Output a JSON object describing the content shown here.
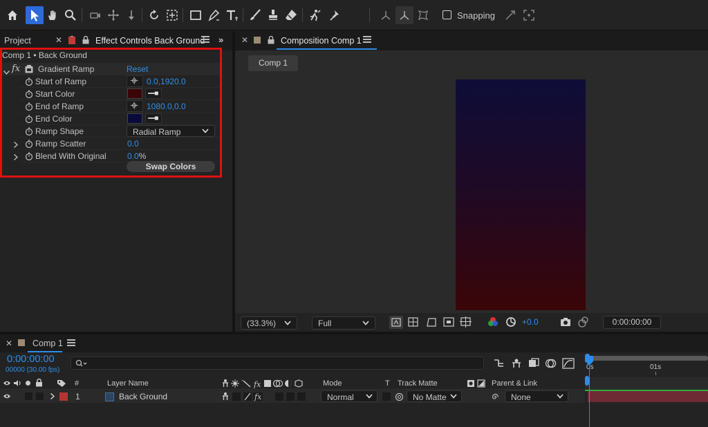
{
  "toolbar": {
    "snapping_label": "Snapping",
    "tools": [
      "home-icon",
      "selection-arrow-icon",
      "hand-icon",
      "zoom-icon",
      "orbit-camera-icon",
      "pan-behind-icon",
      "track-z-icon",
      "rotate-icon",
      "anchor-point-icon",
      "rectangle-icon",
      "pen-icon",
      "type-icon",
      "brush-icon",
      "clone-stamp-icon",
      "eraser-icon",
      "roto-brush-icon",
      "puppet-pin-icon"
    ]
  },
  "project_panel": {
    "tab_label": "Project"
  },
  "effect_controls": {
    "tab_label": "Effect Controls Back Ground",
    "breadcrumb": "Comp 1 • Back Ground",
    "effect_name": "Gradient Ramp",
    "reset_label": "Reset",
    "fx_label": "fx",
    "properties": [
      {
        "label": "Start of Ramp",
        "value": "0.0,1920.0"
      },
      {
        "label": "Start Color",
        "color": "#3a0508"
      },
      {
        "label": "End of Ramp",
        "value": "1080.0,0.0"
      },
      {
        "label": "End Color",
        "color": "#0a0a3a"
      },
      {
        "label": "Ramp Shape",
        "value": "Radial Ramp"
      },
      {
        "label": "Ramp Scatter",
        "value": "0.0"
      },
      {
        "label": "Blend With Original",
        "value": "0.0",
        "unit": "%"
      }
    ],
    "swap_label": "Swap Colors"
  },
  "composition": {
    "tab_label": "Composition Comp 1",
    "comp_button": "Comp 1",
    "zoom": "(33.3%)",
    "resolution": "Full",
    "exposure": "+0.0",
    "timecode": "0:00:00:00",
    "gradient_top": "#0e0d38",
    "gradient_bottom": "#3a0508"
  },
  "timeline": {
    "tab_label": "Comp 1",
    "timecode": "0:00:00:00",
    "frames": "00000 (30.00 fps)",
    "search_placeholder": "",
    "ruler_labels": [
      "0s",
      "01s"
    ],
    "columns": {
      "hash": "#",
      "layer_name": "Layer Name",
      "mode": "Mode",
      "t": "T",
      "track_matte": "Track Matte",
      "parent": "Parent & Link"
    },
    "layer": {
      "number": "1",
      "name": "Back Ground",
      "mode": "Normal",
      "matte": "No Matte",
      "parent": "None",
      "label_color": "#b43434",
      "bar_color": "#6e2b33"
    }
  },
  "annotation": {
    "highlight_color": "#e01010"
  }
}
